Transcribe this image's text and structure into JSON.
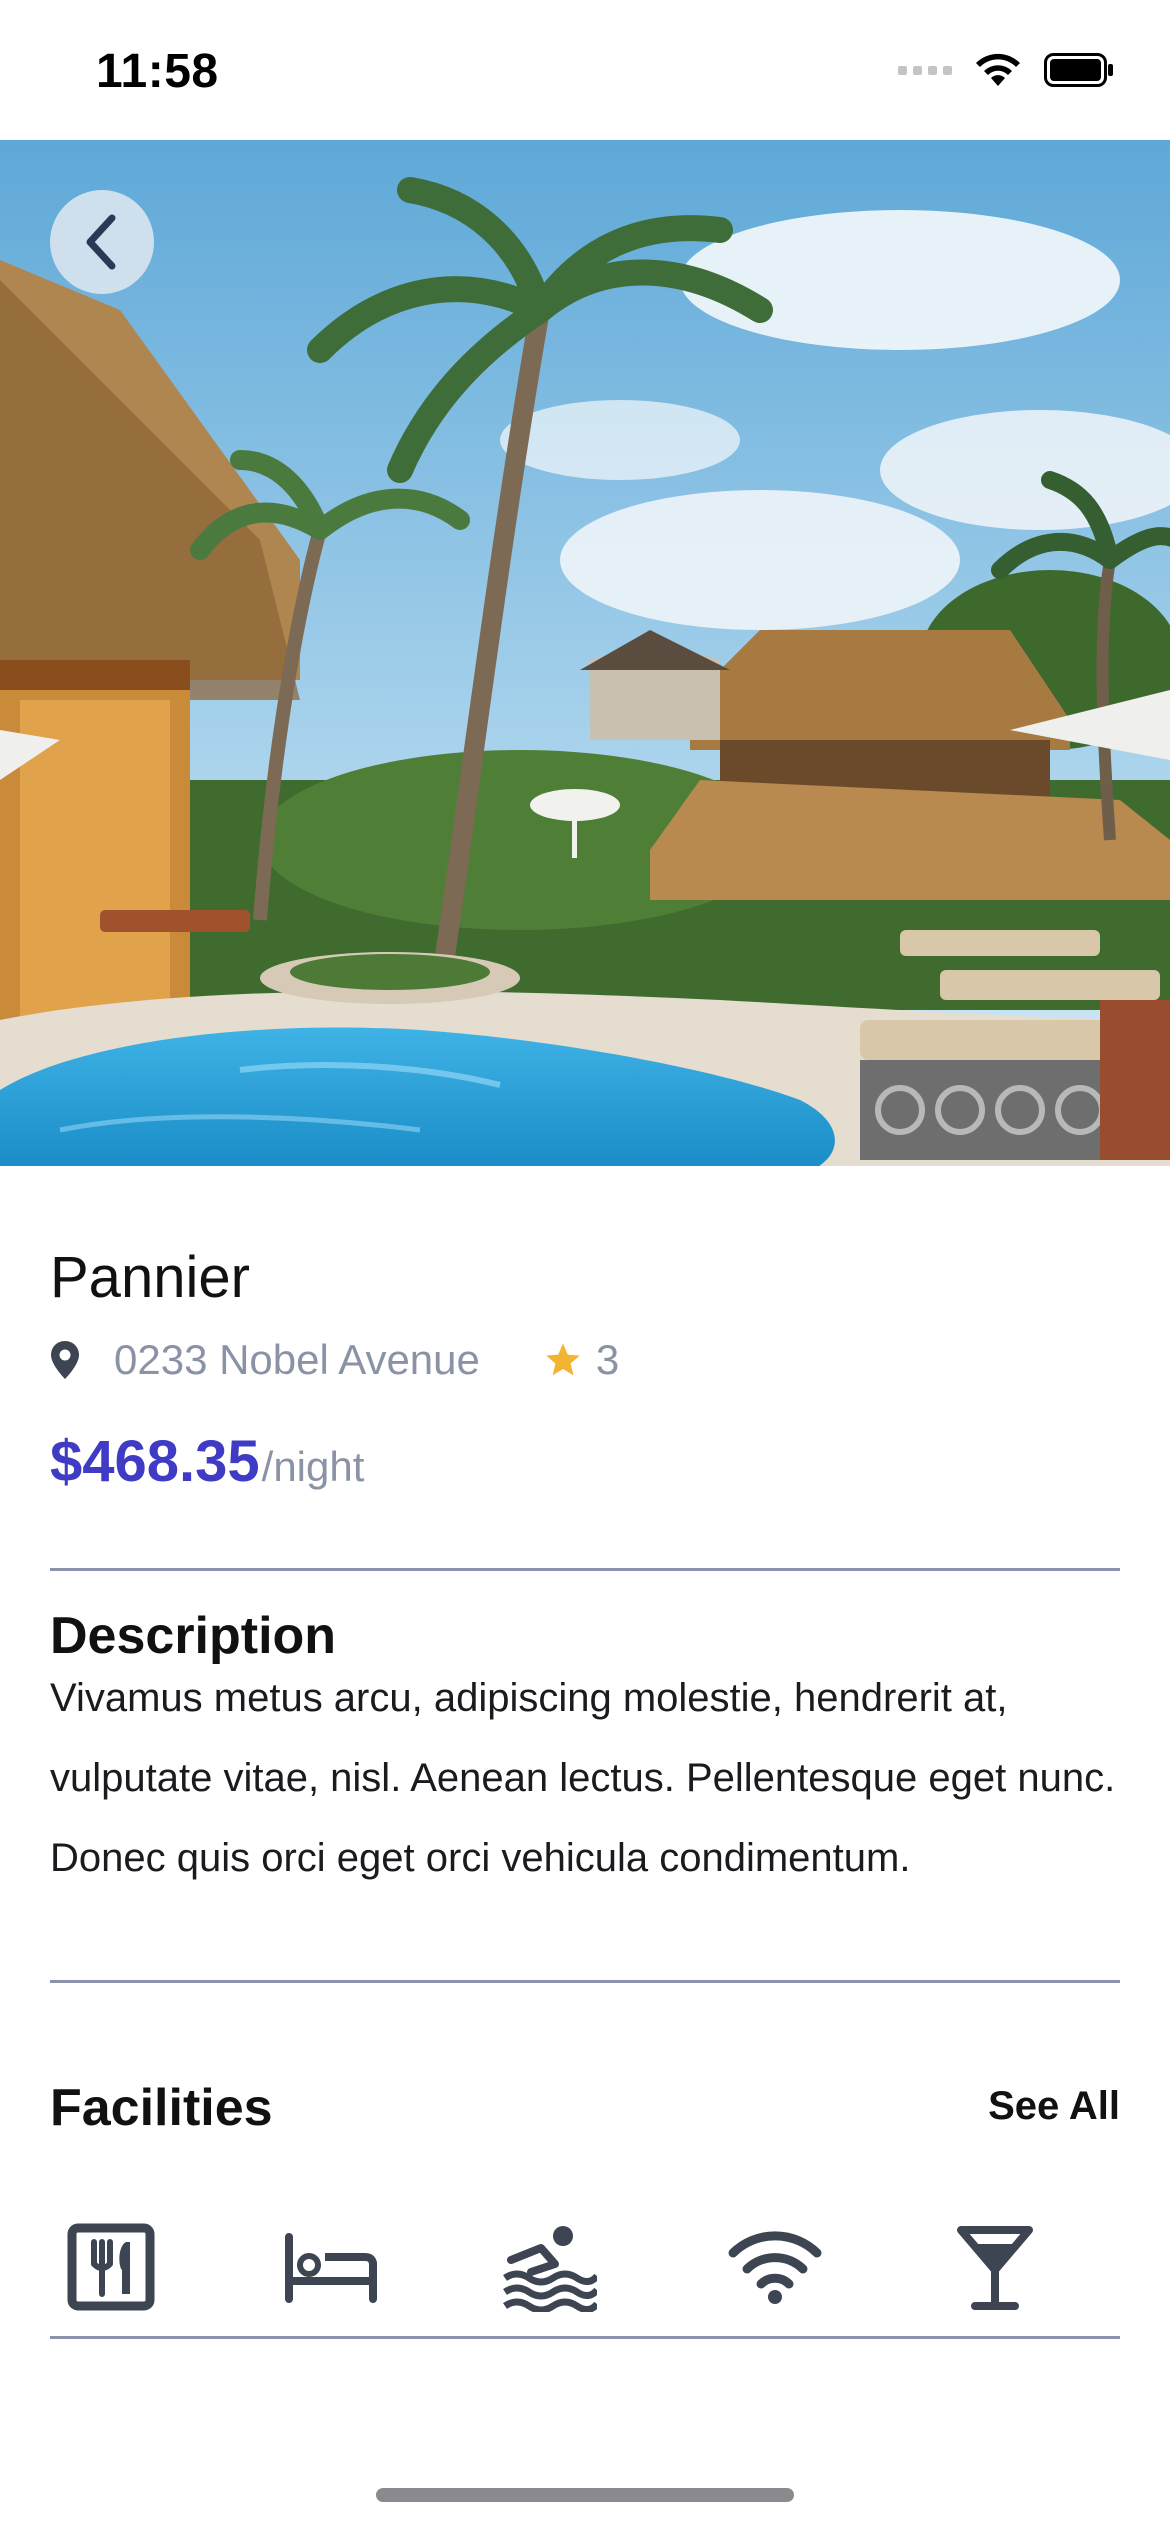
{
  "status_bar": {
    "time": "11:58"
  },
  "hero": {
    "image_alt": "Resort pool with palm trees"
  },
  "hotel": {
    "name": "Pannier",
    "address": "0233 Nobel Avenue",
    "rating": "3",
    "price": "$468.35",
    "price_unit": "/night"
  },
  "description": {
    "title": "Description",
    "text": "Vivamus metus arcu, adipiscing molestie, hendrerit at, vulputate vitae, nisl. Aenean lectus. Pellentesque eget nunc. Donec quis orci eget orci vehicula condimentum."
  },
  "facilities": {
    "title": "Facilities",
    "see_all": "See All",
    "items": [
      {
        "icon": "restaurant-icon"
      },
      {
        "icon": "bed-icon"
      },
      {
        "icon": "swimming-pool-icon"
      },
      {
        "icon": "wifi-icon"
      },
      {
        "icon": "bar-cocktail-icon"
      }
    ]
  },
  "colors": {
    "accent": "#3f3bc4",
    "muted_text": "#8a93a6",
    "divider": "#8c94ad",
    "star": "#f2b533",
    "icon": "#3d4452"
  }
}
